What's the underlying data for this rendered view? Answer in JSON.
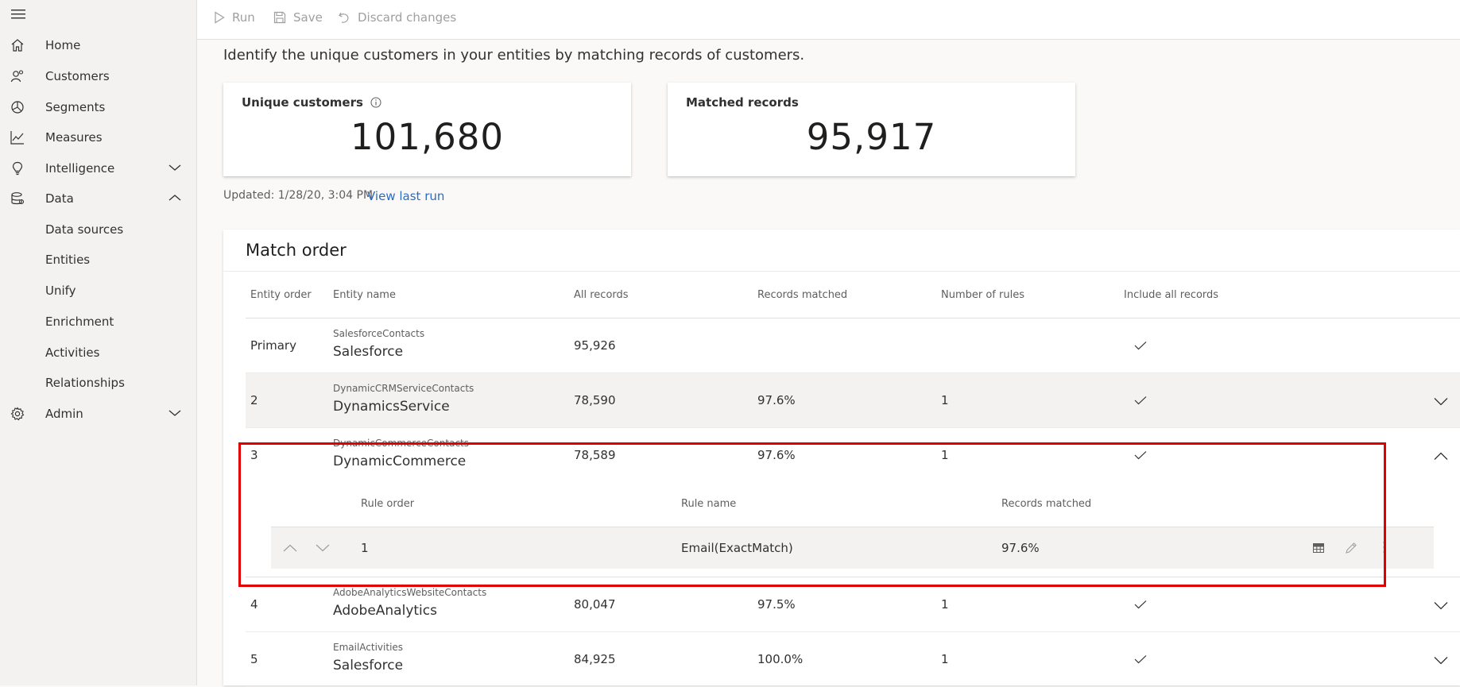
{
  "sidebar": {
    "items": [
      {
        "label": "Home",
        "icon": "home-icon"
      },
      {
        "label": "Customers",
        "icon": "customers-icon"
      },
      {
        "label": "Segments",
        "icon": "segments-icon"
      },
      {
        "label": "Measures",
        "icon": "measures-icon"
      },
      {
        "label": "Intelligence",
        "icon": "lightbulb-icon",
        "expanded": false
      },
      {
        "label": "Data",
        "icon": "data-icon",
        "expanded": true
      },
      {
        "label": "Data sources"
      },
      {
        "label": "Entities"
      },
      {
        "label": "Unify"
      },
      {
        "label": "Enrichment"
      },
      {
        "label": "Activities"
      },
      {
        "label": "Relationships"
      },
      {
        "label": "Admin",
        "icon": "gear-icon",
        "expanded": false
      }
    ]
  },
  "toolbar": {
    "run_label": "Run",
    "save_label": "Save",
    "discard_label": "Discard changes"
  },
  "description": "Identify the unique customers in your entities by matching records of customers.",
  "cards": {
    "unique": {
      "title": "Unique customers",
      "value": "101,680"
    },
    "matched": {
      "title": "Matched records",
      "value": "95,917"
    }
  },
  "updated": "Updated: 1/28/20, 3:04 PM",
  "view_last_run": "View last run",
  "match_order": {
    "title": "Match order",
    "headers": {
      "entity_order": "Entity order",
      "entity_name": "Entity name",
      "all_records": "All records",
      "records_matched": "Records matched",
      "number_of_rules": "Number of rules",
      "include_all": "Include all records"
    },
    "rows": [
      {
        "order": "Primary",
        "entity": "SalesforceContacts",
        "source": "Salesforce",
        "all": "95,926",
        "matched": "",
        "rules": "",
        "include": true,
        "expanded": null
      },
      {
        "order": "2",
        "entity": "DynamicCRMServiceContacts",
        "source": "DynamicsService",
        "all": "78,590",
        "matched": "97.6%",
        "rules": "1",
        "include": true,
        "expanded": false
      },
      {
        "order": "3",
        "entity": "DynamicCommerceContacts",
        "source": "DynamicCommerce",
        "all": "78,589",
        "matched": "97.6%",
        "rules": "1",
        "include": true,
        "expanded": true
      },
      {
        "order": "4",
        "entity": "AdobeAnalyticsWebsiteContacts",
        "source": "AdobeAnalytics",
        "all": "80,047",
        "matched": "97.5%",
        "rules": "1",
        "include": true,
        "expanded": false
      },
      {
        "order": "5",
        "entity": "EmailActivities",
        "source": "Salesforce",
        "all": "84,925",
        "matched": "100.0%",
        "rules": "1",
        "include": true,
        "expanded": false
      }
    ],
    "rules": {
      "headers": {
        "rule_order": "Rule order",
        "rule_name": "Rule name",
        "records_matched": "Records matched"
      },
      "items": [
        {
          "order": "1",
          "name": "Email(ExactMatch)",
          "matched": "97.6%"
        }
      ]
    }
  },
  "colors": {
    "accent": "#2b6cc4",
    "highlight": "#e00000"
  }
}
